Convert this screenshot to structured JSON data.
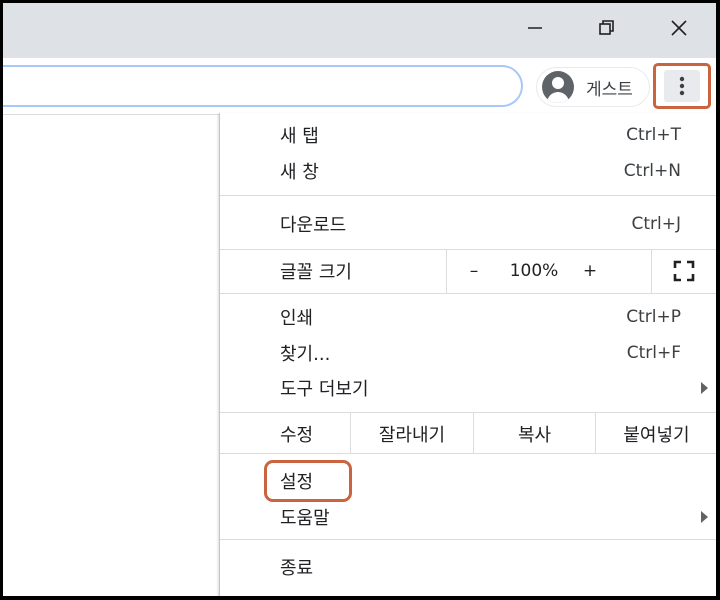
{
  "window": {
    "minimize_icon": "minimize-icon",
    "restore_icon": "restore-icon",
    "close_icon": "close-icon"
  },
  "toolbar": {
    "omnibox_value": "",
    "profile_label": "게스트",
    "menu_icon": "more-vert-icon"
  },
  "menu": {
    "new_tab": {
      "label": "새 탭",
      "shortcut": "Ctrl+T"
    },
    "new_window": {
      "label": "새 창",
      "shortcut": "Ctrl+N"
    },
    "downloads": {
      "label": "다운로드",
      "shortcut": "Ctrl+J"
    },
    "zoom": {
      "label": "글꼴 크기",
      "minus": "–",
      "value": "100%",
      "plus": "+",
      "fullscreen_icon": "fullscreen-icon"
    },
    "print": {
      "label": "인쇄",
      "shortcut": "Ctrl+P"
    },
    "find": {
      "label": "찾기...",
      "shortcut": "Ctrl+F"
    },
    "more_tools": {
      "label": "도구 더보기"
    },
    "edit": {
      "label": "수정",
      "cut": "잘라내기",
      "copy": "복사",
      "paste": "붙여넣기"
    },
    "settings": {
      "label": "설정"
    },
    "help": {
      "label": "도움말"
    },
    "exit": {
      "label": "종료"
    }
  },
  "colors": {
    "highlight": "#c9643f",
    "omnibox_border": "#a8c7fa",
    "titlebar": "#dee1e6"
  }
}
